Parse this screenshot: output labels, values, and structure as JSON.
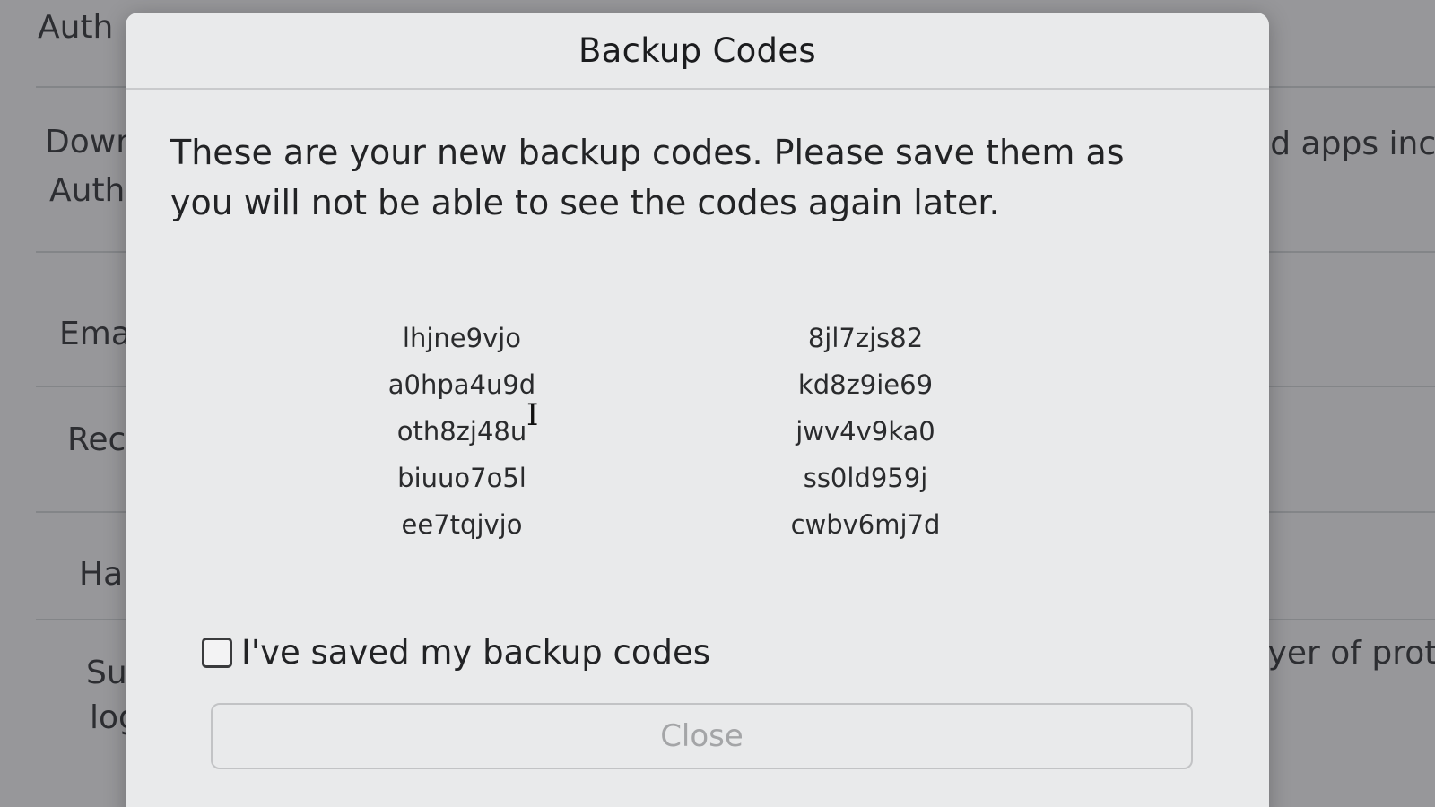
{
  "background": {
    "auth_title": "Auth",
    "download_line1": "Dowr",
    "download_line2": "Auth",
    "connected_apps": "ted apps inc",
    "email": "Email",
    "recovery": "Rece",
    "hardware": "Hard",
    "support_line1": "Supp",
    "support_line2": "loggi",
    "protection": "a layer of prot"
  },
  "modal": {
    "title": "Backup Codes",
    "message": "These are your new backup codes. Please save them as you will not be able to see the codes again later.",
    "codes": [
      "lhjne9vjo",
      "8jl7zjs82",
      "a0hpa4u9d",
      "kd8z9ie69",
      "oth8zj48u",
      "jwv4v9ka0",
      "biuuo7o5l",
      "ss0ld959j",
      "ee7tqjvjo",
      "cwbv6mj7d"
    ],
    "confirm_label": "I've saved my backup codes",
    "confirm_checked": false,
    "close_label": "Close"
  },
  "icons": {
    "cursor": "text-cursor-icon"
  },
  "colors": {
    "modal_bg": "#e9eaeb",
    "overlay": "#8f9193",
    "disabled_text": "#a4a5a7"
  }
}
